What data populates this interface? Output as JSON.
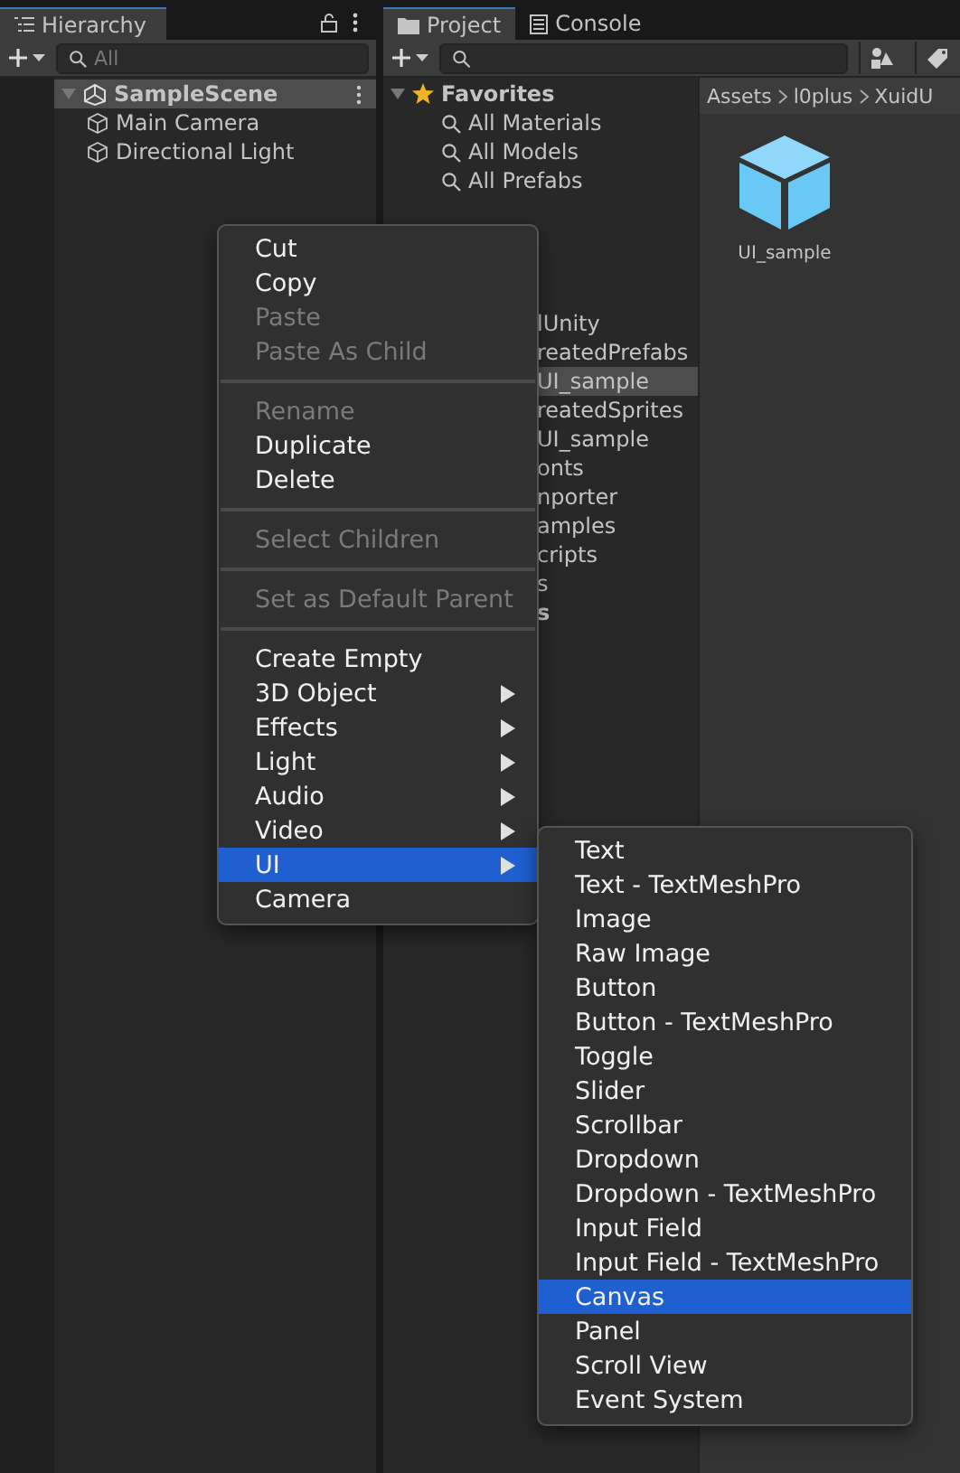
{
  "hierarchy": {
    "tab": "Hierarchy",
    "search": {
      "placeholder": "All"
    },
    "items": [
      {
        "label": "SampleScene",
        "kind": "scene",
        "selected": true,
        "expanded": true
      },
      {
        "label": "Main Camera",
        "kind": "object",
        "selected": false
      },
      {
        "label": "Directional Light",
        "kind": "object",
        "selected": false
      }
    ]
  },
  "project": {
    "tabs": [
      {
        "label": "Project",
        "selected": true
      },
      {
        "label": "Console",
        "selected": false
      }
    ],
    "favorites": {
      "label": "Favorites",
      "items": [
        "All Materials",
        "All Models",
        "All Prefabs"
      ]
    },
    "tree": [
      {
        "label": "lUnity",
        "selected": false
      },
      {
        "label": "reatedPrefabs",
        "selected": false
      },
      {
        "label": "UI_sample",
        "selected": true
      },
      {
        "label": "reatedSprites",
        "selected": false
      },
      {
        "label": "UI_sample",
        "selected": false
      },
      {
        "label": "onts",
        "selected": false
      },
      {
        "label": "nporter",
        "selected": false
      },
      {
        "label": "amples",
        "selected": false
      },
      {
        "label": "cripts",
        "selected": false
      },
      {
        "label": "s",
        "selected": false
      },
      {
        "label": "s",
        "selected": false,
        "bold": true
      }
    ],
    "breadcrumb": [
      "Assets",
      "l0plus",
      "XuidU"
    ],
    "assets": [
      {
        "label": "UI_sample"
      }
    ]
  },
  "context_menu": [
    {
      "kind": "item",
      "label": "Cut",
      "disabled": false
    },
    {
      "kind": "item",
      "label": "Copy",
      "disabled": false
    },
    {
      "kind": "item",
      "label": "Paste",
      "disabled": true
    },
    {
      "kind": "item",
      "label": "Paste As Child",
      "disabled": true
    },
    {
      "kind": "separator"
    },
    {
      "kind": "item",
      "label": "Rename",
      "disabled": true
    },
    {
      "kind": "item",
      "label": "Duplicate",
      "disabled": false
    },
    {
      "kind": "item",
      "label": "Delete",
      "disabled": false
    },
    {
      "kind": "separator"
    },
    {
      "kind": "item",
      "label": "Select Children",
      "disabled": true
    },
    {
      "kind": "separator"
    },
    {
      "kind": "item",
      "label": "Set as Default Parent",
      "disabled": true
    },
    {
      "kind": "separator"
    },
    {
      "kind": "item",
      "label": "Create Empty",
      "disabled": false
    },
    {
      "kind": "submenu",
      "label": "3D Object",
      "disabled": false,
      "selected": false
    },
    {
      "kind": "submenu",
      "label": "Effects",
      "disabled": false,
      "selected": false
    },
    {
      "kind": "submenu",
      "label": "Light",
      "disabled": false,
      "selected": false
    },
    {
      "kind": "submenu",
      "label": "Audio",
      "disabled": false,
      "selected": false
    },
    {
      "kind": "submenu",
      "label": "Video",
      "disabled": false,
      "selected": false
    },
    {
      "kind": "submenu",
      "label": "UI",
      "disabled": false,
      "selected": true
    },
    {
      "kind": "item",
      "label": "Camera",
      "disabled": false
    }
  ],
  "ui_submenu": [
    {
      "label": "Text",
      "selected": false
    },
    {
      "label": "Text - TextMeshPro",
      "selected": false
    },
    {
      "label": "Image",
      "selected": false
    },
    {
      "label": "Raw Image",
      "selected": false
    },
    {
      "label": "Button",
      "selected": false
    },
    {
      "label": "Button - TextMeshPro",
      "selected": false
    },
    {
      "label": "Toggle",
      "selected": false
    },
    {
      "label": "Slider",
      "selected": false
    },
    {
      "label": "Scrollbar",
      "selected": false
    },
    {
      "label": "Dropdown",
      "selected": false
    },
    {
      "label": "Dropdown - TextMeshPro",
      "selected": false
    },
    {
      "label": "Input Field",
      "selected": false
    },
    {
      "label": "Input Field - TextMeshPro",
      "selected": false
    },
    {
      "label": "Canvas",
      "selected": true
    },
    {
      "label": "Panel",
      "selected": false
    },
    {
      "label": "Scroll View",
      "selected": false
    },
    {
      "label": "Event System",
      "selected": false
    }
  ]
}
